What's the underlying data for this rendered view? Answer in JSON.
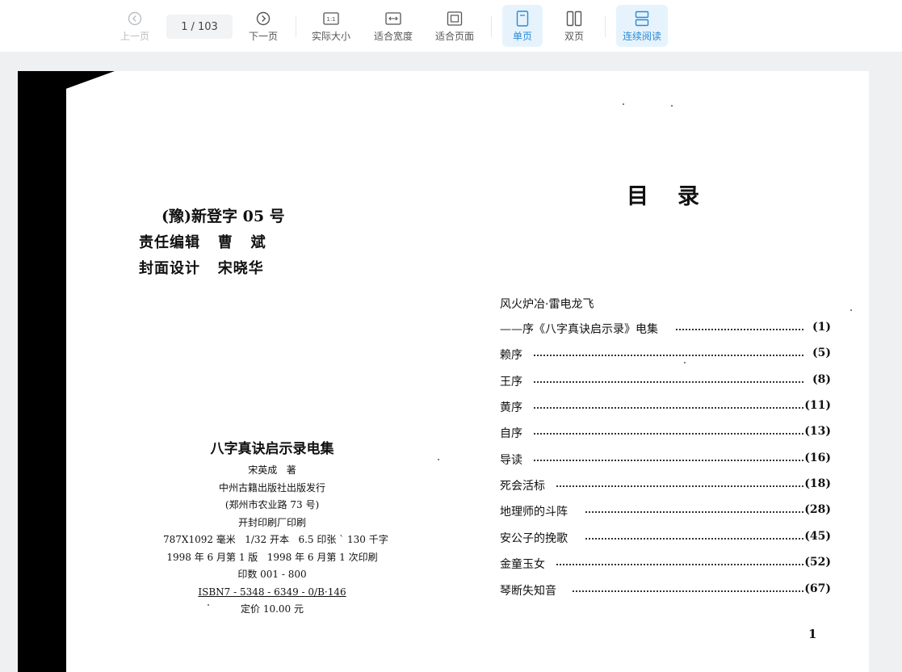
{
  "toolbar": {
    "prev_label": "上一页",
    "current_page": "1",
    "total_pages": "/ 103",
    "next_label": "下一页",
    "actual_size_label": "实际大小",
    "actual_size_icon_text": "1:1",
    "fit_width_label": "适合宽度",
    "fit_page_label": "适合页面",
    "single_page_label": "单页",
    "double_page_label": "双页",
    "continuous_label": "连续阅读",
    "accent_color": "#2a8ad6",
    "icons": [
      "chevron-left-circle-icon",
      "chevron-right-circle-icon",
      "actual-size-icon",
      "fit-width-icon",
      "fit-page-icon",
      "single-page-icon",
      "double-page-icon",
      "continuous-read-icon"
    ]
  },
  "document": {
    "left": {
      "registration": "(豫)新登字 05 号",
      "editor_line": "责任编辑   曹   斌",
      "cover_line": "封面设计   宋晓华",
      "book_title": "八字真诀启示录电集",
      "author": "宋英成   著",
      "publisher": "中州古籍出版社出版发行",
      "address": "(郑州市农业路 73 号)",
      "printer": "开封印刷厂印刷",
      "specs": "787X1092 毫米   1/32 开本   6.5 印张 ` 130 千字",
      "edition": "1998 年 6 月第 1 版   1998 年 6 月第 1 次印刷",
      "print_run": "印数 001 - 800",
      "isbn": "ISBN7 - 5348 - 6349 - 0/B·146",
      "price": "定价 10.00 元"
    },
    "right": {
      "toc_title": "目录",
      "toc": [
        {
          "label": "风火炉冶·雷电龙飞",
          "page": ""
        },
        {
          "label": "——序《八字真诀启示录》电集",
          "page": "(1)"
        },
        {
          "label": "赖序",
          "page": "(5)"
        },
        {
          "label": "王序",
          "page": "(8)"
        },
        {
          "label": "黄序",
          "page": "(11)"
        },
        {
          "label": "自序",
          "page": "(13)"
        },
        {
          "label": "导读",
          "page": "(16)"
        },
        {
          "label": "死会活标",
          "page": "(18)"
        },
        {
          "label": "地理师的斗阵",
          "page": "(28)"
        },
        {
          "label": "安公子的挽歌",
          "page": "(45)"
        },
        {
          "label": "金童玉女",
          "page": "(52)"
        },
        {
          "label": "琴断失知音",
          "page": "(67)"
        }
      ],
      "page_number": "1"
    }
  }
}
